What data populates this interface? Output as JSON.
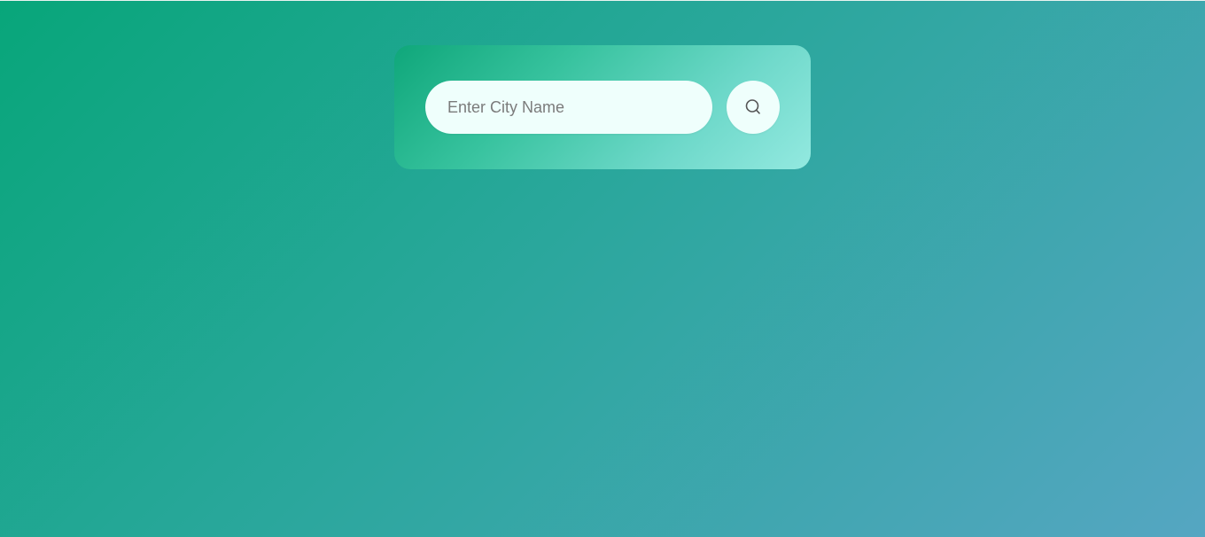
{
  "search": {
    "placeholder": "Enter City Name",
    "value": "",
    "button_icon": "search-icon"
  },
  "colors": {
    "background_start": "#08a67a",
    "background_end": "#55a6c2",
    "card_start": "#0fa77a",
    "card_end": "#93e9e0",
    "input_background": "#effffc",
    "icon_color": "#555555"
  }
}
